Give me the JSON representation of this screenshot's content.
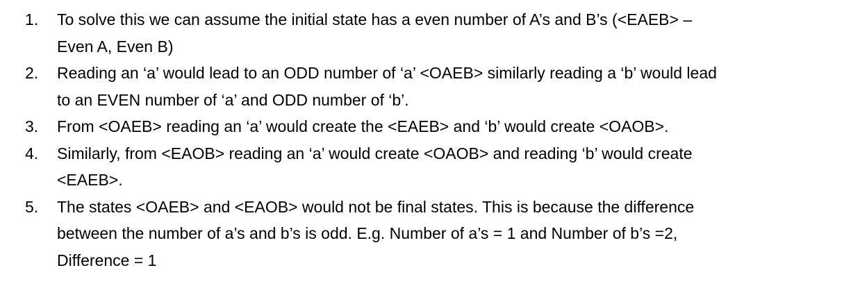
{
  "items": [
    {
      "number": "1.",
      "lines": [
        "To solve this we can assume the initial state has a even number of A’s and B’s (<EAEB> –",
        "Even A, Even B)"
      ]
    },
    {
      "number": "2.",
      "lines": [
        "Reading an ‘a’ would lead to an ODD number of ‘a’ <OAEB> similarly reading a ‘b’ would lead",
        "to an EVEN number of ‘a’ and ODD number of ‘b’."
      ]
    },
    {
      "number": "3.",
      "lines": [
        "From <OAEB> reading an ‘a’ would create the <EAEB> and ‘b’ would create <OAOB>."
      ]
    },
    {
      "number": "4.",
      "lines": [
        "Similarly, from <EAOB> reading an ‘a’ would create <OAOB> and reading ‘b’ would create",
        "<EAEB>."
      ]
    },
    {
      "number": "5.",
      "lines": [
        "The states <OAEB> and <EAOB> would not be final states. This is because the difference",
        "between the number of a’s and b’s is odd. E.g. Number of a’s = 1 and Number of b’s =2,",
        "Difference = 1"
      ]
    }
  ]
}
